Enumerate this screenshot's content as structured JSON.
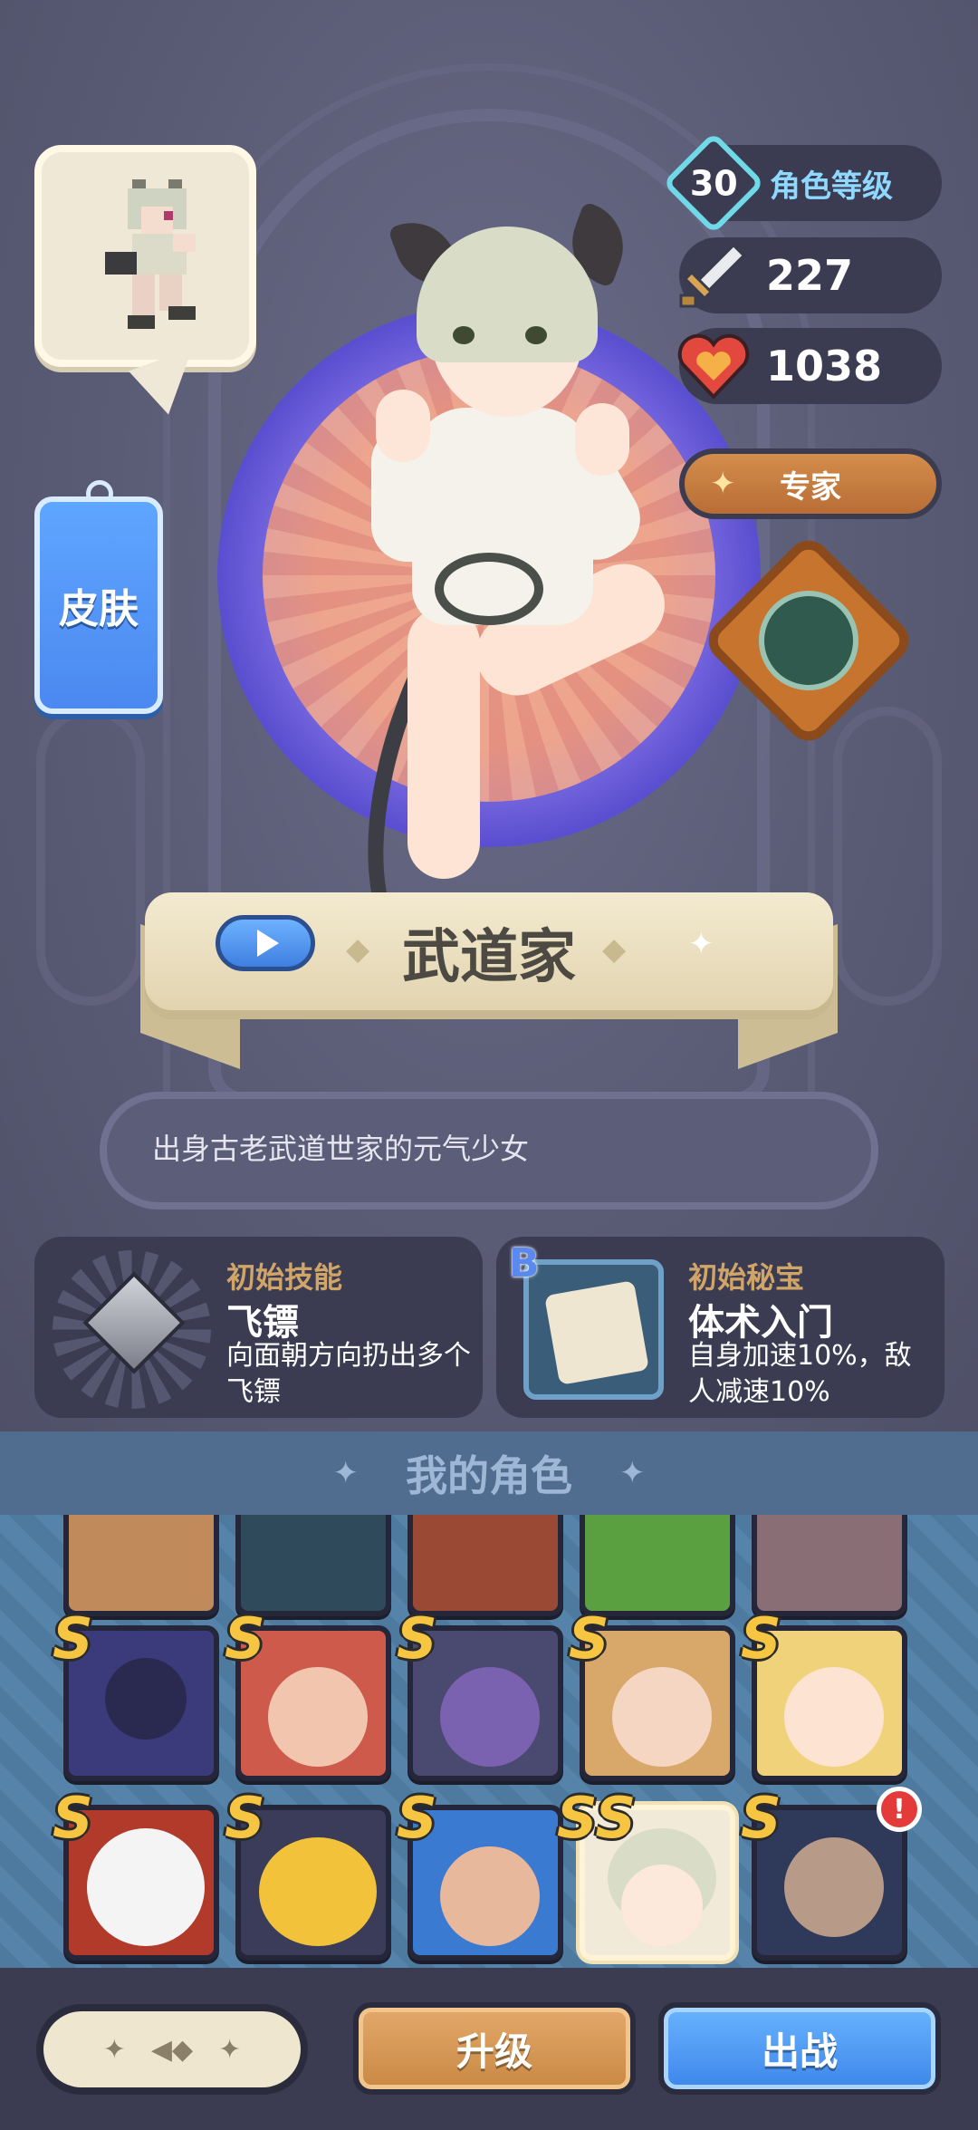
{
  "stats": {
    "level": "30",
    "level_label": "角色等级",
    "attack": "227",
    "health": "1038",
    "expert_label": "专家"
  },
  "skin_label": "皮肤",
  "hero": {
    "name": "武道家",
    "description": "出身古老武道世家的元气少女"
  },
  "skill_card": {
    "title": "初始技能",
    "name": "飞镖",
    "text": "向面朝方向扔出多个飞镖"
  },
  "relic_card": {
    "badge": "B",
    "title": "初始秘宝",
    "name": "体术入门",
    "text": "自身加速10%，敌人减速10%"
  },
  "roster": {
    "title": "我的角色",
    "rank_label": "S",
    "selected_rank_label": "SS",
    "alert_label": "!"
  },
  "bottom": {
    "upgrade_label": "升级",
    "battle_label": "出战"
  },
  "colors": {
    "accent_blue": "#4b88f0",
    "accent_orange": "#c98944",
    "rank_gold": "#f6c542"
  }
}
